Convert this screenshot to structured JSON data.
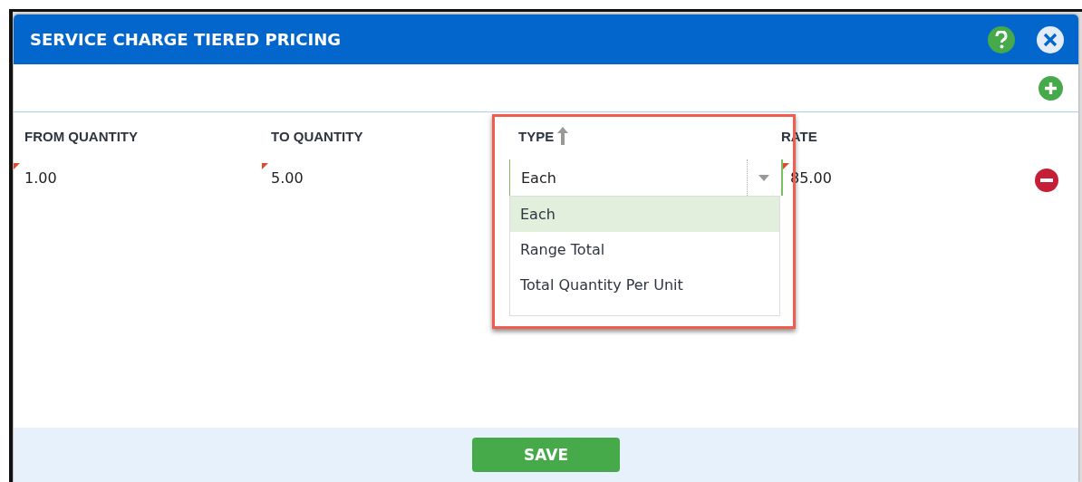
{
  "dialog": {
    "title": "SERVICE CHARGE TIERED PRICING"
  },
  "columns": [
    {
      "label": "FROM QUANTITY"
    },
    {
      "label": "TO QUANTITY"
    },
    {
      "label": "TYPE",
      "sorted_ascending": true
    },
    {
      "label": "RATE"
    }
  ],
  "rows": [
    {
      "from": {
        "value": "1.00",
        "edited": true
      },
      "to": {
        "value": "5.00",
        "edited": true
      },
      "type": {
        "value": "Each"
      },
      "rate": {
        "value": "85.00",
        "edited": true
      }
    }
  ],
  "type_dropdown": {
    "open": true,
    "options": [
      {
        "label": "Each",
        "selected": true
      },
      {
        "label": "Range Total",
        "selected": false
      },
      {
        "label": "Total Quantity Per Unit",
        "selected": false
      }
    ]
  },
  "highlight_box": true,
  "buttons": [
    {
      "label": "SAVE"
    }
  ]
}
